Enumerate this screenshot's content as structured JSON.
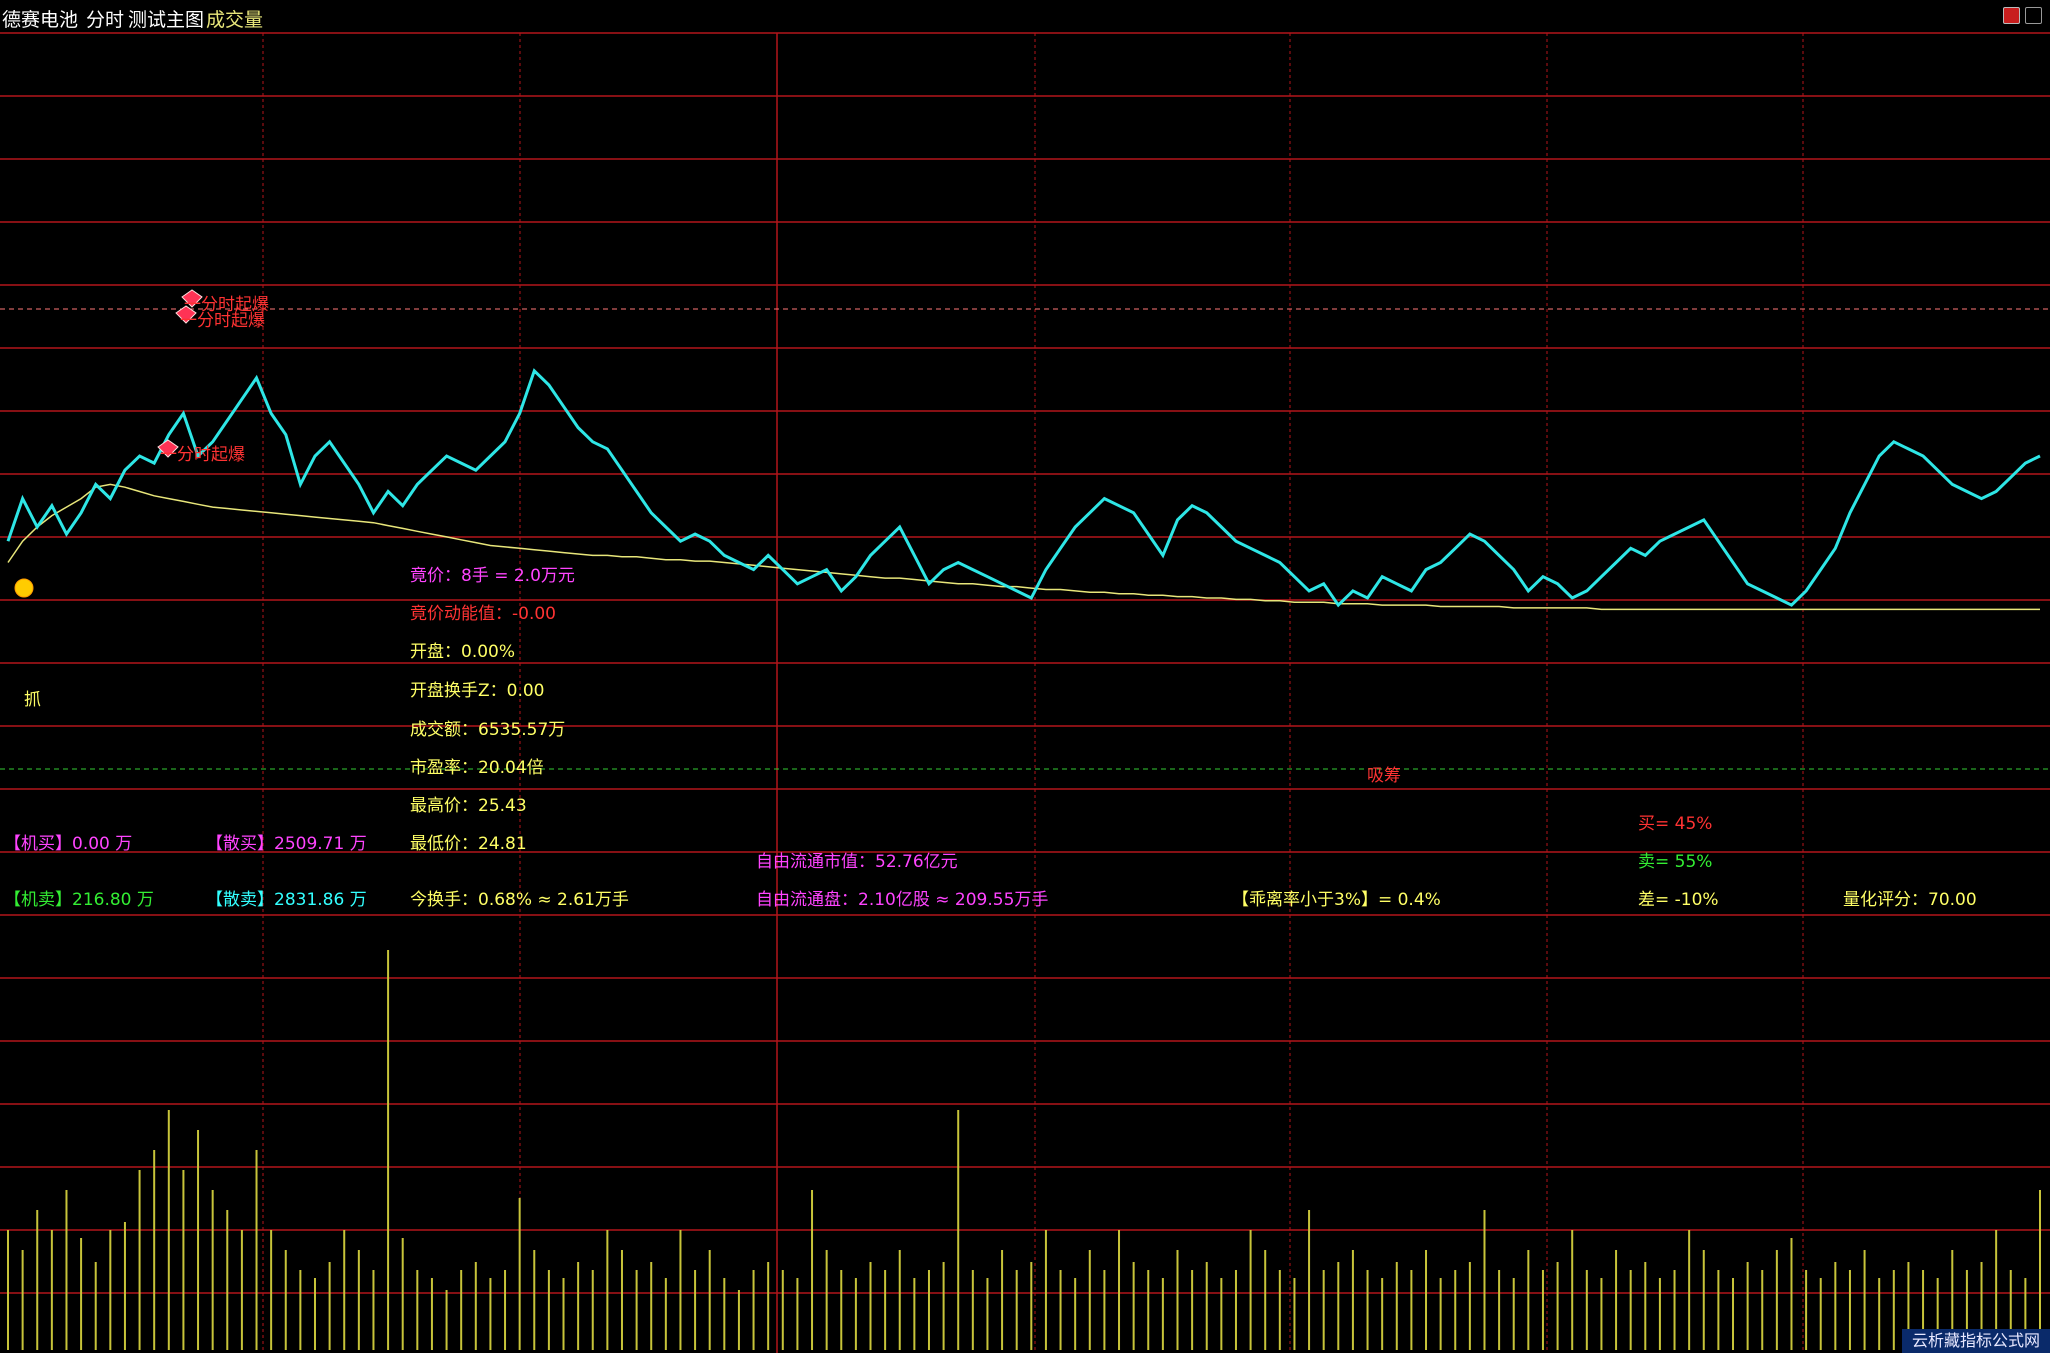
{
  "header": {
    "stock_name": "德赛电池",
    "view_mode": "分时",
    "main_chart": "测试主图",
    "indicator": "成交量"
  },
  "colors": {
    "grid_red": "#b3151a",
    "price_cyan": "#2ee6e6",
    "price_green": "#33dd33",
    "price_red": "#ff2233",
    "avg_yellow": "#e8e67a",
    "volume_yellow": "#c8c43a",
    "label_magenta": "#ff44ff",
    "label_yellow": "#ffff66",
    "label_red": "#ff3333",
    "label_green": "#33ee33",
    "label_cyan": "#33ffff"
  },
  "markers": [
    {
      "text": "一分时起爆",
      "icon": "gem-icon"
    },
    {
      "text": "一分时起爆",
      "icon": "gem-icon"
    },
    {
      "text": "一分时起爆",
      "icon": "gem-icon"
    }
  ],
  "marker_grab": "抓",
  "marker_smile_icon": "smiley-icon",
  "marker_suck": "吸筹",
  "stats": {
    "auction": "竟价：8手 = 2.0万元",
    "auction_momentum": "竟价动能值：-0.00",
    "open": "开盘：0.00%",
    "open_turnover": "开盘换手Z：0.00",
    "turnover_amount": "成交额：6535.57万",
    "pe": "市盈率：20.04倍",
    "high": "最高价：25.43",
    "low": "最低价：24.81",
    "today_turnover": "今换手：0.68% ≈ 2.61万手",
    "free_float_value": "自由流通市值：52.76亿元",
    "free_float_shares": "自由流通盘：2.10亿股 ≈ 209.55万手",
    "deviation": "【乖离率小于3%】= 0.4%",
    "buy_pct": "买= 45%",
    "sell_pct": "卖= 55%",
    "diff_pct": "差= -10%",
    "quant_score": "量化评分：70.00"
  },
  "flows": {
    "inst_buy_label": "【机买】",
    "inst_buy_value": "0.00 万",
    "retail_buy_label": "【散买】",
    "retail_buy_value": "2509.71 万",
    "inst_sell_label": "【机卖】",
    "inst_sell_value": "216.80 万",
    "retail_sell_label": "【散卖】",
    "retail_sell_value": "2831.86 万"
  },
  "watermark": "云析藏指标公式网",
  "series": {
    "price_y": [
      360,
      330,
      350,
      335,
      355,
      340,
      320,
      330,
      310,
      300,
      305,
      285,
      270,
      300,
      290,
      275,
      260,
      245,
      270,
      285,
      320,
      300,
      290,
      305,
      320,
      340,
      325,
      335,
      320,
      310,
      300,
      305,
      310,
      300,
      290,
      270,
      240,
      250,
      265,
      280,
      290,
      295,
      310,
      325,
      340,
      350,
      360,
      355,
      360,
      370,
      375,
      380,
      370,
      380,
      390,
      385,
      380,
      395,
      385,
      370,
      360,
      350,
      370,
      390,
      380,
      375,
      380,
      385,
      390,
      395,
      400,
      380,
      365,
      350,
      340,
      330,
      335,
      340,
      355,
      370,
      345,
      335,
      340,
      350,
      360,
      365,
      370,
      375,
      385,
      395,
      390,
      405,
      395,
      400,
      385,
      390,
      395,
      380,
      375,
      365,
      355,
      360,
      370,
      380,
      395,
      385,
      390,
      400,
      395,
      385,
      375,
      365,
      370,
      360,
      355,
      350,
      345,
      360,
      375,
      390,
      395,
      400,
      405,
      395,
      380,
      365,
      340,
      320,
      300,
      290,
      295,
      300,
      310,
      320,
      325,
      330,
      325,
      315,
      305,
      300
    ],
    "avg_y": [
      375,
      360,
      350,
      342,
      336,
      330,
      322,
      320,
      322,
      325,
      328,
      330,
      332,
      334,
      336,
      337,
      338,
      339,
      340,
      341,
      342,
      343,
      344,
      345,
      346,
      347,
      349,
      351,
      353,
      355,
      357,
      359,
      361,
      363,
      364,
      365,
      366,
      367,
      368,
      369,
      370,
      370,
      371,
      371,
      372,
      373,
      373,
      374,
      374,
      375,
      376,
      377,
      378,
      379,
      380,
      381,
      382,
      383,
      384,
      385,
      386,
      386,
      387,
      388,
      389,
      390,
      390,
      391,
      392,
      392,
      393,
      394,
      394,
      395,
      396,
      396,
      397,
      397,
      398,
      398,
      399,
      399,
      400,
      400,
      401,
      401,
      402,
      402,
      403,
      403,
      403,
      404,
      404,
      404,
      405,
      405,
      405,
      405,
      406,
      406,
      406,
      406,
      406,
      407,
      407,
      407,
      407,
      407,
      407,
      408,
      408,
      408,
      408,
      408,
      408,
      408,
      408,
      408,
      408,
      408,
      408,
      408,
      408,
      408,
      408,
      408,
      408,
      408,
      408,
      408,
      408,
      408,
      408,
      408,
      408,
      408,
      408,
      408,
      408,
      408
    ],
    "volume": [
      0.3,
      0.25,
      0.35,
      0.3,
      0.4,
      0.28,
      0.22,
      0.3,
      0.32,
      0.45,
      0.5,
      0.6,
      0.45,
      0.55,
      0.4,
      0.35,
      0.3,
      0.5,
      0.3,
      0.25,
      0.2,
      0.18,
      0.22,
      0.3,
      0.25,
      0.2,
      1.0,
      0.28,
      0.2,
      0.18,
      0.15,
      0.2,
      0.22,
      0.18,
      0.2,
      0.38,
      0.25,
      0.2,
      0.18,
      0.22,
      0.2,
      0.3,
      0.25,
      0.2,
      0.22,
      0.18,
      0.3,
      0.2,
      0.25,
      0.18,
      0.15,
      0.2,
      0.22,
      0.2,
      0.18,
      0.4,
      0.25,
      0.2,
      0.18,
      0.22,
      0.2,
      0.25,
      0.18,
      0.2,
      0.22,
      0.6,
      0.2,
      0.18,
      0.25,
      0.2,
      0.22,
      0.3,
      0.2,
      0.18,
      0.25,
      0.2,
      0.3,
      0.22,
      0.2,
      0.18,
      0.25,
      0.2,
      0.22,
      0.18,
      0.2,
      0.3,
      0.25,
      0.2,
      0.18,
      0.35,
      0.2,
      0.22,
      0.25,
      0.2,
      0.18,
      0.22,
      0.2,
      0.25,
      0.18,
      0.2,
      0.22,
      0.35,
      0.2,
      0.18,
      0.25,
      0.2,
      0.22,
      0.3,
      0.2,
      0.18,
      0.25,
      0.2,
      0.22,
      0.18,
      0.2,
      0.3,
      0.25,
      0.2,
      0.18,
      0.22,
      0.2,
      0.25,
      0.28,
      0.2,
      0.18,
      0.22,
      0.2,
      0.25,
      0.18,
      0.2,
      0.22,
      0.2,
      0.18,
      0.25,
      0.2,
      0.22,
      0.3,
      0.2,
      0.18,
      0.4
    ]
  }
}
